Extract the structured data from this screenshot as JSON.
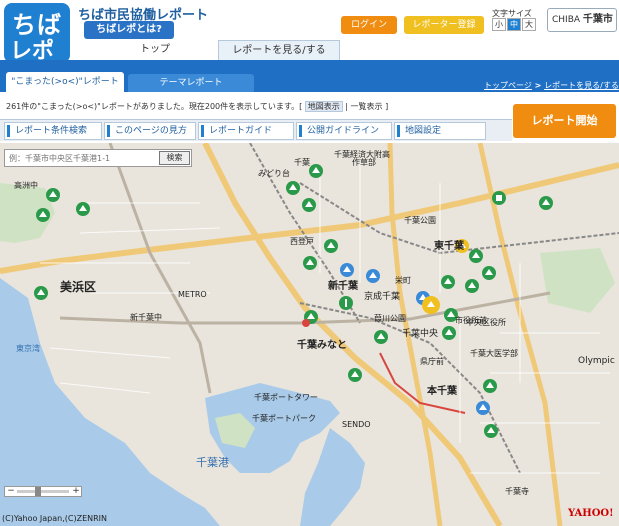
{
  "header": {
    "logo_line1": "ちば",
    "logo_line2": "レポ",
    "site_title": "ちば市民協働レポート",
    "about_button": "ちばレポとは?",
    "login_button": "ログイン",
    "register_button": "レポーター登録",
    "font_size_label": "文字サイズ",
    "font_sizes": [
      "小",
      "中",
      "大"
    ],
    "city_badge_small": "CHIBA",
    "city_badge_name": "千葉市"
  },
  "main_nav": {
    "top": "トップ",
    "reports": "レポートを見る/する"
  },
  "tabs": {
    "active": "\"こまった(>o<)\"レポート",
    "theme": "テーマレポート"
  },
  "breadcrumb": {
    "top": "トップページ",
    "sep": " > ",
    "current": "レポートを見る/する"
  },
  "summary": {
    "text": "261件の\"こまった(>o<)\"レポートがありました。現在200件を表示しています。[",
    "map_mode": "地図表示",
    "divider": "|",
    "list_mode": "一覧表示",
    "end": "]"
  },
  "start_button": "レポート開始",
  "subtabs": [
    "レポート条件検索",
    "このページの見方",
    "レポートガイド",
    "公開ガイドライン",
    "地図設定"
  ],
  "search": {
    "placeholder": "例：千葉市中央区千葉港1-1",
    "button": "検索"
  },
  "map": {
    "labels": [
      {
        "text": "千葉"
      },
      {
        "text": "東千葉"
      },
      {
        "text": "新千葉"
      },
      {
        "text": "京成千葉"
      },
      {
        "text": "千葉みなと"
      },
      {
        "text": "千葉中央"
      },
      {
        "text": "本千葉"
      },
      {
        "text": "作草部"
      },
      {
        "text": "西登戸"
      },
      {
        "text": "みどり台"
      },
      {
        "text": "千葉公園"
      },
      {
        "text": "栄町"
      },
      {
        "text": "葭川公園"
      },
      {
        "text": "市役所前"
      },
      {
        "text": "県庁前"
      },
      {
        "text": "千葉寺"
      },
      {
        "text": "美浜区"
      },
      {
        "text": "東京湾"
      },
      {
        "text": "千葉港"
      },
      {
        "text": "千葉ポートタワー"
      },
      {
        "text": "千葉ポートパーク"
      },
      {
        "text": "高洲中"
      },
      {
        "text": "中央区役所"
      },
      {
        "text": "千葉大医学部"
      },
      {
        "text": "Olympic"
      },
      {
        "text": "METRO"
      },
      {
        "text": "SENDO"
      },
      {
        "text": "新千葉中"
      },
      {
        "text": "千葉経済大附高"
      }
    ],
    "zoom_minus": "−",
    "zoom_plus": "+",
    "copyright": "(C)Yahoo Japan,(C)ZENRIN",
    "provider_logo": "YAHOO!"
  },
  "colors": {
    "brand_blue": "#1f6fc4",
    "orange": "#f08c10",
    "pin_green": "#2a9a4a",
    "pin_blue": "#3a8ad8",
    "pin_yellow": "#f0c020",
    "water": "#a9cbe9",
    "land": "#e9e5dc"
  }
}
